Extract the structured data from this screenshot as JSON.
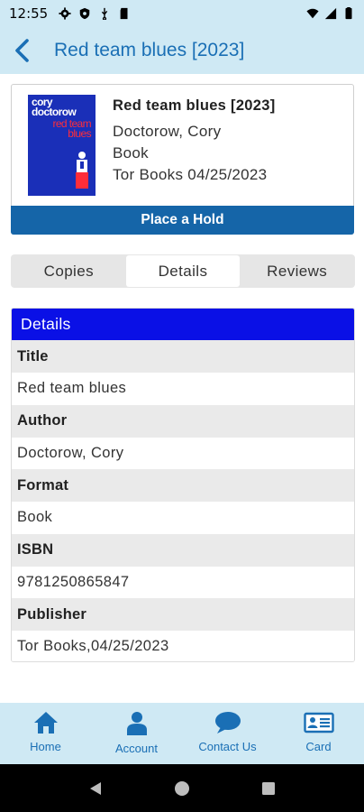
{
  "status_bar": {
    "time": "12:55"
  },
  "app_bar": {
    "title": "Red team blues [2023]"
  },
  "book": {
    "title": "Red team blues [2023]",
    "author": "Doctorow, Cory",
    "format": "Book",
    "publisher_line": "Tor Books 04/25/2023",
    "cover_author": "cory doctorow",
    "cover_title": "red team blues",
    "hold_label": "Place a Hold"
  },
  "tabs": [
    {
      "label": "Copies"
    },
    {
      "label": "Details",
      "active": true
    },
    {
      "label": "Reviews"
    }
  ],
  "details": {
    "header": "Details",
    "rows": [
      {
        "label": "Title",
        "value": "Red team blues"
      },
      {
        "label": "Author",
        "value": "Doctorow, Cory"
      },
      {
        "label": "Format",
        "value": "Book"
      },
      {
        "label": "ISBN",
        "value": "9781250865847"
      },
      {
        "label": "Publisher",
        "value": "Tor Books,04/25/2023"
      }
    ]
  },
  "bottom_nav": [
    {
      "label": "Home",
      "icon": "home-icon"
    },
    {
      "label": "Account",
      "icon": "account-icon"
    },
    {
      "label": "Contact Us",
      "icon": "chat-icon"
    },
    {
      "label": "Card",
      "icon": "card-icon"
    }
  ],
  "colors": {
    "app_bar": "#cfe9f4",
    "accent": "#1a6fb5",
    "hold_button": "#1565a8",
    "details_header": "#0a10e6"
  }
}
